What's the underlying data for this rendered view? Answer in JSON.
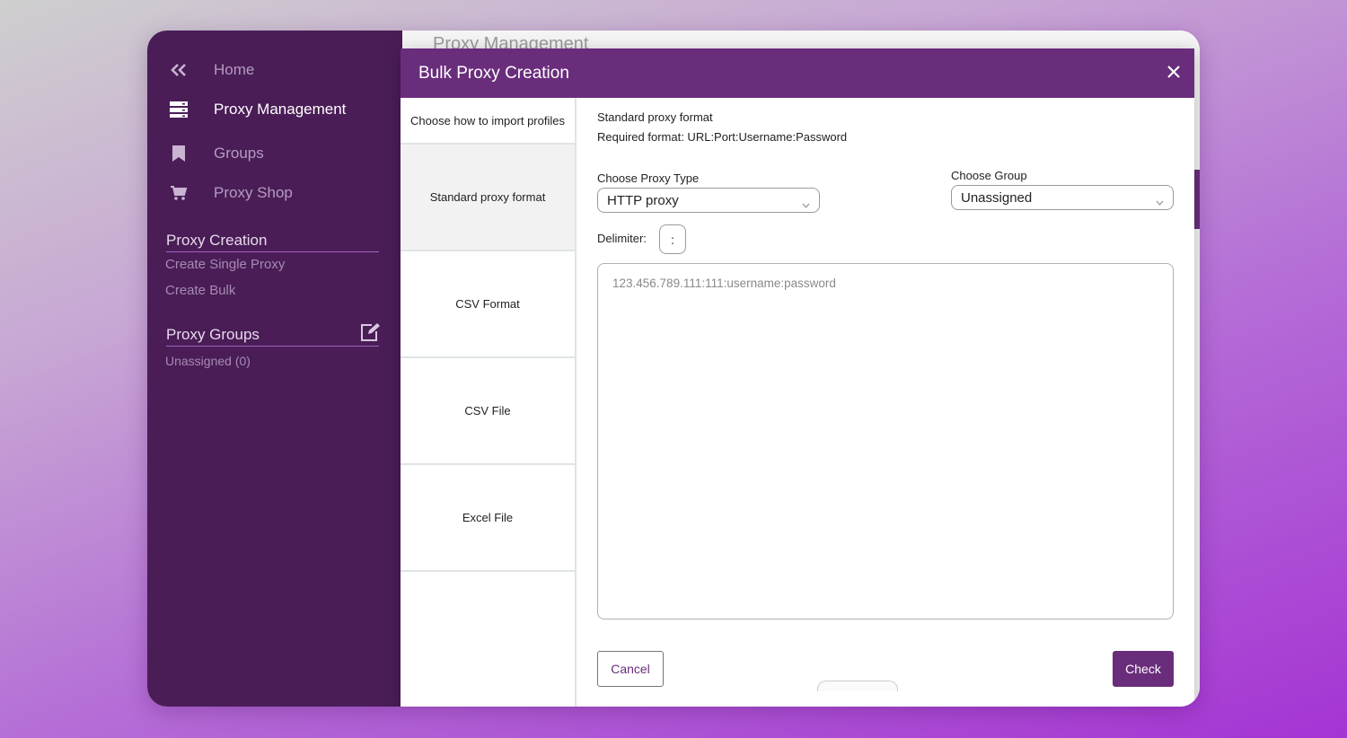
{
  "sidebar": {
    "nav": [
      {
        "label": "Home",
        "icon": "chevrons-left-icon"
      },
      {
        "label": "Proxy Management",
        "icon": "server-icon",
        "active": true
      },
      {
        "label": "Groups",
        "icon": "bookmark-icon"
      },
      {
        "label": "Proxy Shop",
        "icon": "cart-icon"
      }
    ],
    "proxy_creation": {
      "title": "Proxy Creation",
      "links": [
        "Create Single Proxy",
        "Create Bulk"
      ]
    },
    "proxy_groups": {
      "title": "Proxy Groups",
      "items": [
        "Unassigned (0)"
      ]
    }
  },
  "background": {
    "page_title": "Proxy Management"
  },
  "modal": {
    "title": "Bulk Proxy Creation",
    "left_heading": "Choose how to import profiles",
    "options": [
      "Standard proxy format",
      "CSV Format",
      "CSV File",
      "Excel File"
    ],
    "selected_option": "Standard proxy format",
    "format_title": "Standard proxy format",
    "format_required": "Required format: URL:Port:Username:Password",
    "proxy_type_label": "Choose Proxy Type",
    "proxy_type_value": "HTTP proxy",
    "group_label": "Choose Group",
    "group_value": "Unassigned",
    "delimiter_label": "Delimiter:",
    "delimiter_value": ":",
    "textarea_placeholder": "123.456.789.111:111:username:password",
    "cancel_label": "Cancel",
    "check_label": "Check"
  },
  "colors": {
    "sidebar": "#4a1d57",
    "accent": "#6a2d7c"
  }
}
